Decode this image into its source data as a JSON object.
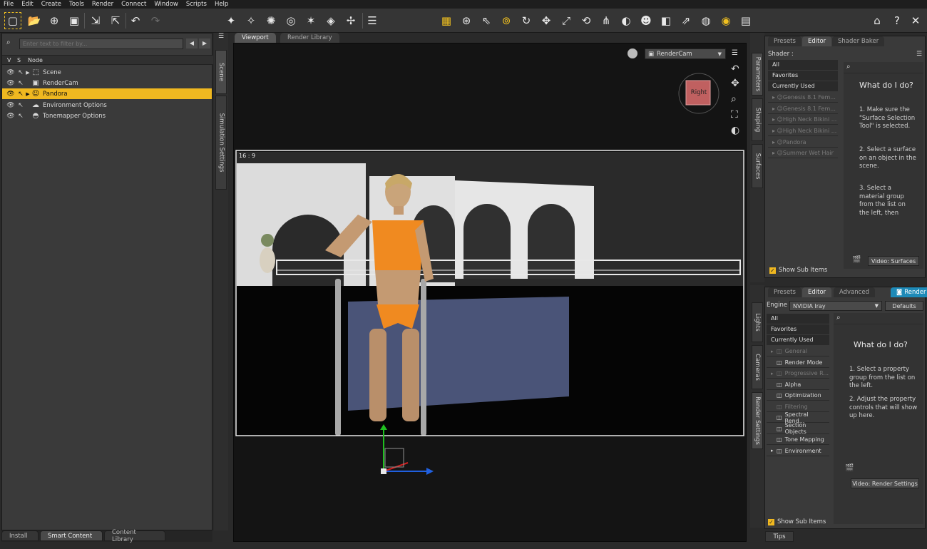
{
  "menu": [
    "File",
    "Edit",
    "Create",
    "Tools",
    "Render",
    "Connect",
    "Window",
    "Scripts",
    "Help"
  ],
  "scene_panel": {
    "filter_placeholder": "Enter text to filter by...",
    "col_v": "V",
    "col_s": "S",
    "col_node": "Node",
    "nodes": [
      {
        "label": "Scene",
        "icon": "scene-group-icon"
      },
      {
        "label": "RenderCam",
        "icon": "camera-icon"
      },
      {
        "label": "Pandora",
        "icon": "figure-icon",
        "selected": true
      },
      {
        "label": "Environment Options",
        "icon": "environment-icon"
      },
      {
        "label": "Tonemapper Options",
        "icon": "tonemapper-icon"
      }
    ]
  },
  "left_vertical_tabs": [
    "Scene",
    "Simulation Settings"
  ],
  "bottom_tabs": [
    "Install",
    "Smart Content",
    "Content Library"
  ],
  "viewport": {
    "tabs": [
      "Viewport",
      "Render Library"
    ],
    "camera": "RenderCam",
    "aspect": "16 : 9",
    "view_cube_label": "Right"
  },
  "shader_panel": {
    "tabs": [
      "Presets",
      "Editor",
      "Shader Baker"
    ],
    "vertical_tabs": [
      "Parameters",
      "Shaping",
      "Surfaces"
    ],
    "section_label": "Shader :",
    "list": [
      "All",
      "Favorites",
      "Currently Used"
    ],
    "items": [
      "Genesis 8.1 Fem...",
      "Genesis 8.1 Fem...",
      "High Neck Bikini ...",
      "High Neck Bikini ...",
      "Pandora",
      "Summer Wet Hair"
    ],
    "help_title": "What do I do?",
    "steps": [
      "1. Make sure the \"Surface Selection Tool\" is selected.",
      "2. Select a surface on an object in the scene.",
      "3. Select a material group from the list on the left, then"
    ],
    "video_button": "Video: Surfaces",
    "show_sub_items": "Show Sub Items"
  },
  "render_panel": {
    "tabs": [
      "Presets",
      "Editor",
      "Advanced",
      "Render"
    ],
    "vertical_tabs": [
      "Lights",
      "Cameras",
      "Render Settings"
    ],
    "engine_label": "Engine :",
    "engine_value": "NVIDIA Iray",
    "defaults_button": "Defaults",
    "list": [
      "All",
      "Favorites",
      "Currently Used"
    ],
    "items": [
      {
        "label": "General",
        "dim": true,
        "arrow": true
      },
      {
        "label": "Render Mode",
        "dim": false,
        "arrow": false
      },
      {
        "label": "Progressive R...",
        "dim": true,
        "arrow": true
      },
      {
        "label": "Alpha",
        "dim": false,
        "arrow": false
      },
      {
        "label": "Optimization",
        "dim": false,
        "arrow": false
      },
      {
        "label": "Filtering",
        "dim": true,
        "arrow": false
      },
      {
        "label": "Spectral Rend...",
        "dim": false,
        "arrow": false
      },
      {
        "label": "Section Objects",
        "dim": false,
        "arrow": false
      },
      {
        "label": "Tone Mapping",
        "dim": false,
        "arrow": false
      },
      {
        "label": "Environment",
        "dim": false,
        "arrow": true
      }
    ],
    "help_title": "What do I do?",
    "steps": [
      "1. Select a property group from the list on the left.",
      "2. Adjust the property controls that will show up here."
    ],
    "video_button": "Video: Render Settings",
    "show_sub_items": "Show Sub Items",
    "tips_tab": "Tips"
  },
  "colors": {
    "accent": "#f0b820",
    "render_tab": "#1e8ab8"
  }
}
